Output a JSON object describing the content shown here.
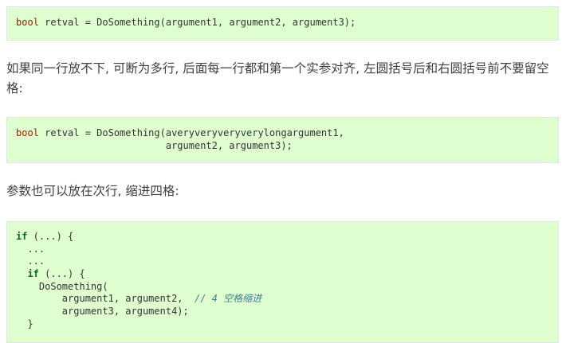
{
  "block1": {
    "line1": {
      "type": "bool",
      "rest": " retval = DoSomething(argument1, argument2, argument3);"
    }
  },
  "para1": "如果同一行放不下, 可断为多行, 后面每一行都和第一个实参对齐, 左圆括号后和右圆括号前不要留空格:",
  "block2": {
    "line1": {
      "type": "bool",
      "rest": " retval = DoSomething(averyveryveryverylongargument1,"
    },
    "line2": "                          argument2, argument3);"
  },
  "para2": "参数也可以放在次行, 缩进四格:",
  "block3": {
    "line1": {
      "kw": "if",
      "rest": " (...) {"
    },
    "line2": "  ...",
    "line3": "  ...",
    "line4": {
      "indent": "  ",
      "kw": "if",
      "rest": " (...) {"
    },
    "line5": "    DoSomething(",
    "line6": {
      "code": "        argument1, argument2,  ",
      "comment": "// 4 空格缩进"
    },
    "line7": "        argument3, argument4);",
    "line8": "  }"
  }
}
